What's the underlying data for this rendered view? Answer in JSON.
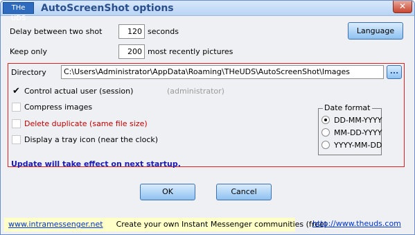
{
  "window": {
    "app_icon_label": "THe UDS",
    "title": "AutoScreenShot options",
    "close_glyph": "✕"
  },
  "delay": {
    "label": "Delay between two shot",
    "value": "120",
    "unit": "seconds"
  },
  "keep": {
    "label": "Keep only",
    "value": "200",
    "suffix": "most recently pictures"
  },
  "language_button": "Language",
  "directory": {
    "label": "Directory",
    "value": "C:\\Users\\Administrator\\AppData\\Roaming\\THeUDS\\AutoScreenShot\\Images",
    "browse_label": "..."
  },
  "options": {
    "control_user": {
      "label": "Control actual user (session)",
      "checked": true,
      "note": "(administrator)"
    },
    "compress": {
      "label": "Compress images",
      "checked": false
    },
    "delete_duplicate": {
      "label": "Delete duplicate (same file size)",
      "checked": false,
      "color": "#c00000"
    },
    "tray_icon": {
      "label": "Display a tray icon (near the clock)",
      "checked": false
    }
  },
  "date_format": {
    "title": "Date format",
    "options": [
      {
        "label": "DD-MM-YYYY",
        "selected": true
      },
      {
        "label": "MM-DD-YYYY",
        "selected": false
      },
      {
        "label": "YYYY-MM-DD",
        "selected": false
      }
    ]
  },
  "notice": "Update will take effect on next startup.",
  "buttons": {
    "ok": "OK",
    "cancel": "Cancel"
  },
  "footer": {
    "link_left": "www.intramessenger.net",
    "tagline": "Create your own Instant Messenger communities (free)",
    "link_right": "http://www.theuds.com"
  },
  "colors": {
    "accent_blue": "#2a4f8a",
    "notice_blue": "#1a1ab0",
    "frame_red": "#e02020",
    "link_blue": "#0033cc"
  }
}
